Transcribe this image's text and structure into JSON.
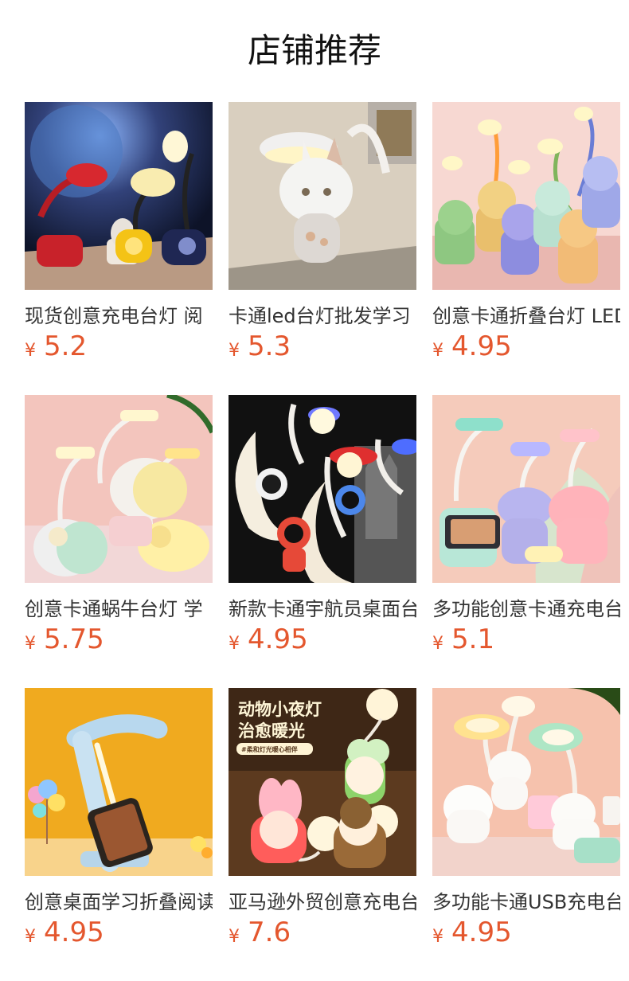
{
  "title": "店铺推荐",
  "currency_symbol": "¥",
  "products": [
    {
      "name": "现货创意充电台灯 阅",
      "price": "5.2",
      "icon": "space-lamp-trio"
    },
    {
      "name": "卡通led台灯批发学习",
      "price": "5.3",
      "icon": "bunny-lamp"
    },
    {
      "name": "创意卡通折叠台灯 LED",
      "price": "4.95",
      "icon": "animal-pen-lamps"
    },
    {
      "name": "创意卡通蜗牛台灯 学",
      "price": "5.75",
      "icon": "snail-lamps"
    },
    {
      "name": "新款卡通宇航员桌面台",
      "price": "4.95",
      "icon": "astronaut-moon-lamps"
    },
    {
      "name": "多功能创意卡通充电台",
      "price": "5.1",
      "icon": "cat-phone-stand-lamps"
    },
    {
      "name": "创意桌面学习折叠阅读",
      "price": "4.95",
      "icon": "folding-phone-lamp"
    },
    {
      "name": "亚马逊外贸创意充电台",
      "price": "7.6",
      "icon": "night-light-figures"
    },
    {
      "name": "多功能卡通USB充电台",
      "price": "4.95",
      "icon": "bear-usb-lamps"
    }
  ],
  "product_8_overlay": {
    "headline_1": "动物小夜灯",
    "headline_2": "治愈暖光",
    "tag": "#柔和灯光暖心相伴"
  }
}
